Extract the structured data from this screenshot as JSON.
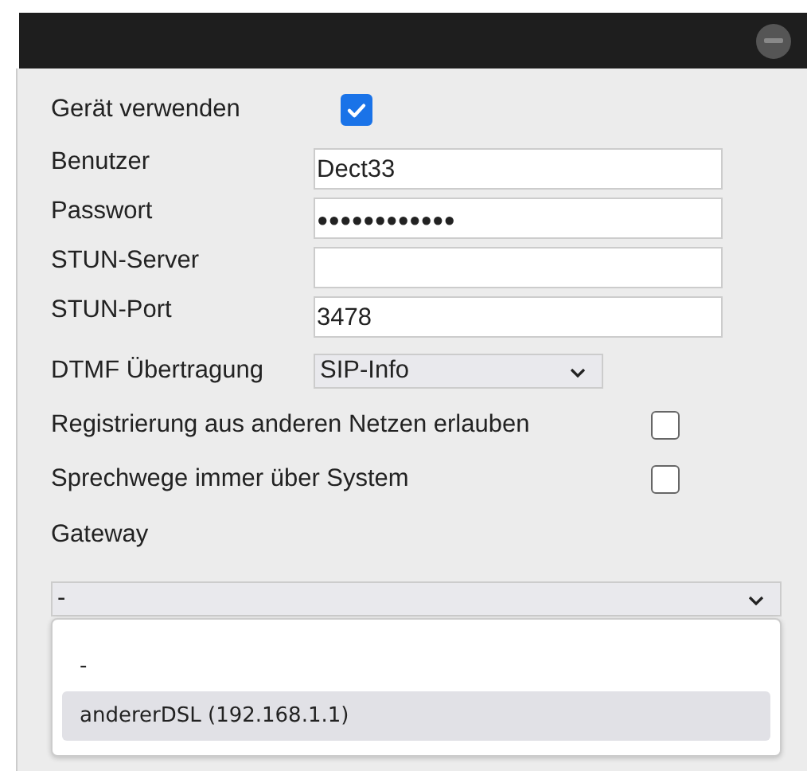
{
  "fields": [
    {
      "kind": "checkbox",
      "label": "Gerät verwenden",
      "checked": true
    },
    {
      "kind": "text",
      "label": "Benutzer",
      "value": "Dect33"
    },
    {
      "kind": "password",
      "label": "Passwort",
      "value": "●●●●●●●●●●●●"
    },
    {
      "kind": "text",
      "label": "STUN-Server"
    },
    {
      "kind": "text",
      "label": "STUN-Port",
      "value": "3478"
    },
    {
      "kind": "select",
      "label": "DTMF Übertragung",
      "value": "SIP-Info"
    },
    {
      "kind": "checkbox",
      "label": "Registrierung aus anderen Netzen erlauben",
      "checked": false
    },
    {
      "kind": "checkbox",
      "label": "Sprechwege immer über System",
      "checked": false
    }
  ],
  "gateway": {
    "label": "Gateway",
    "value": "-",
    "open": true,
    "options": [
      {
        "label": "-",
        "highlighted": false
      },
      {
        "label": "andererDSL (192.168.1.1)",
        "highlighted": true
      }
    ]
  }
}
